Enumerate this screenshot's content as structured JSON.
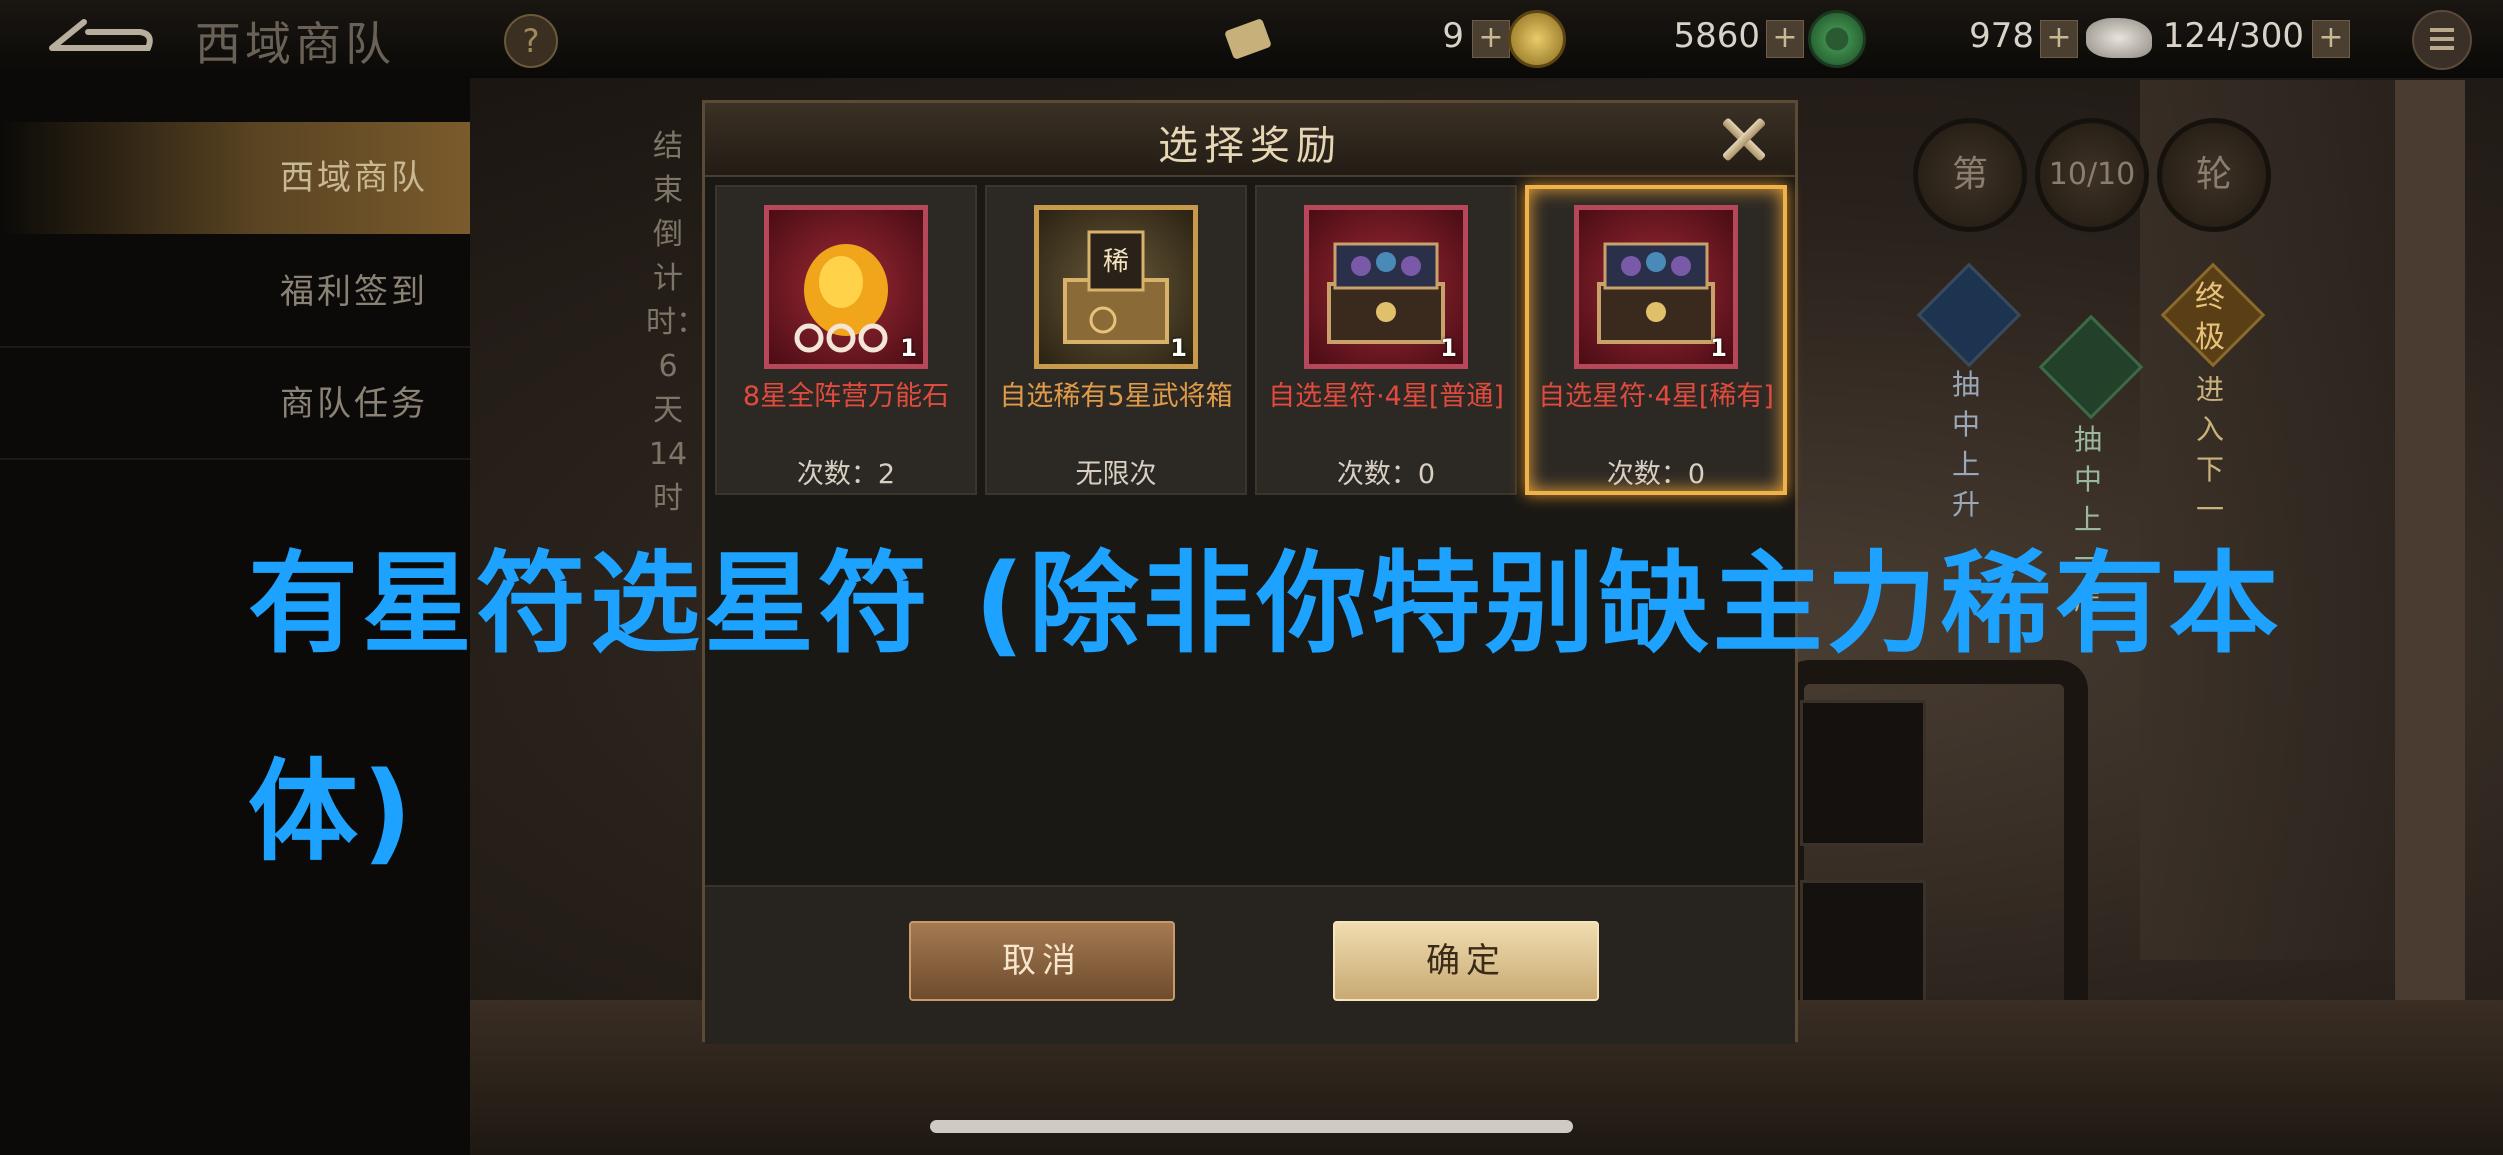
{
  "topbar": {
    "title": "西域商队",
    "help": "?",
    "resources": [
      {
        "name": "scroll",
        "value": "9",
        "plus": "+",
        "icon": "copper-coin-icon",
        "color": "#c9a84a"
      },
      {
        "name": "coins",
        "value": "5860",
        "plus": "+",
        "icon": "jade-coin-icon",
        "color": "#3c8a4a"
      },
      {
        "name": "jade",
        "value": "978",
        "plus": "+",
        "icon": "stone-icon",
        "color": "#c8c4bc"
      },
      {
        "name": "stamina",
        "value": "124/300",
        "plus": "+",
        "icon": "menu-icon",
        "color": "#bba98b"
      }
    ]
  },
  "sidebar": {
    "items": [
      {
        "label": "西域商队",
        "active": true
      },
      {
        "label": "福利签到",
        "active": false
      },
      {
        "label": "商队任务",
        "active": false
      }
    ]
  },
  "countdown": "结束倒计时：6天14时",
  "round": {
    "a": "第",
    "b": "10/10",
    "c": "轮"
  },
  "strips": [
    {
      "text": "抽中上升"
    },
    {
      "text": "抽中上一层"
    },
    {
      "text": "终极",
      "sub": "进入下一"
    }
  ],
  "dialog": {
    "title": "选择奖励",
    "cards": [
      {
        "name": "8星全阵营万能石",
        "qty": "1",
        "count": "次数：2",
        "icon": "fire-stone-icon",
        "selected": false
      },
      {
        "name": "自选稀有5星武将箱",
        "qty": "1",
        "count": "无限次",
        "icon": "rare-chest-icon",
        "selected": false
      },
      {
        "name": "自选星符·4星[普通]",
        "qty": "1",
        "count": "次数：0",
        "icon": "talisman-chest-icon",
        "selected": false
      },
      {
        "name": "自选星符·4星[稀有]",
        "qty": "1",
        "count": "次数：0",
        "icon": "talisman-chest-icon",
        "selected": true
      }
    ],
    "chest_label": "稀",
    "cancel": "取消",
    "confirm": "确定"
  },
  "caption": "有星符选星符 (除非你特别缺主力稀有本体)"
}
